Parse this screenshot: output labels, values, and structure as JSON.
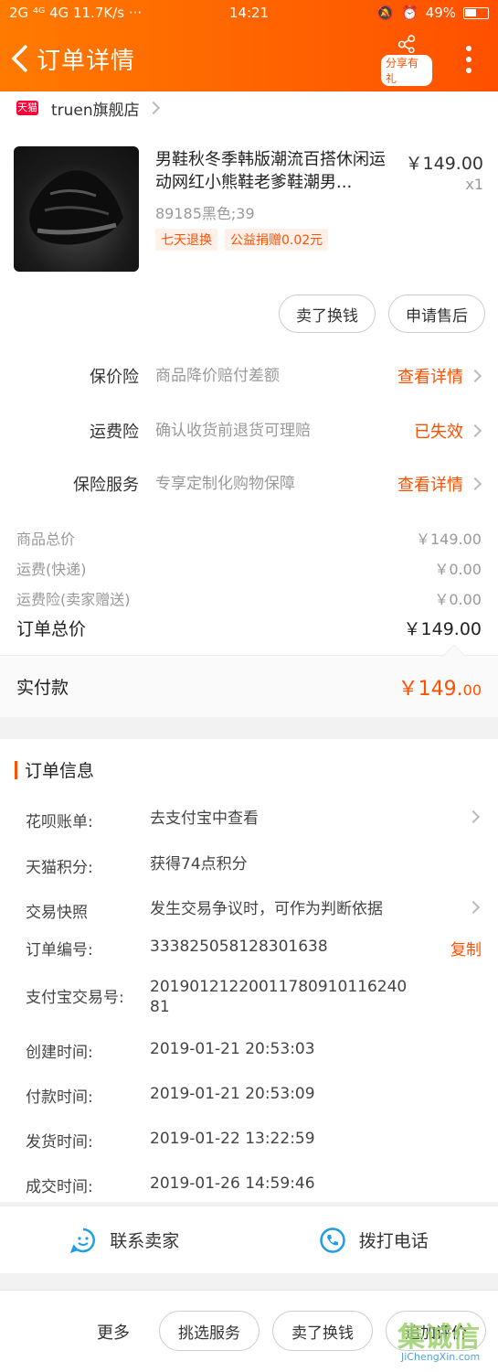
{
  "status": {
    "left": "2G ⁴ᴳ 4G 11.7K/s ···",
    "time": "14:21",
    "battery": "49%"
  },
  "nav": {
    "title": "订单详情",
    "share_label": "分享有礼"
  },
  "shop": {
    "badge": "天猫",
    "name": "truen旗舰店"
  },
  "product": {
    "title": "男鞋秋冬季韩版潮流百搭休闲运动网红小熊鞋老爹鞋潮男...",
    "price": "￥149.00",
    "qty": "x1",
    "sku": "89185黑色;39",
    "tags": [
      "七天退换",
      "公益捐赠0.02元"
    ],
    "buttons": [
      "卖了换钱",
      "申请售后"
    ]
  },
  "insurance": [
    {
      "label": "保价险",
      "desc": "商品降价赔付差额",
      "link": "查看详情"
    },
    {
      "label": "运费险",
      "desc": "确认收货前退货可理赔",
      "link": "已失效"
    },
    {
      "label": "保险服务",
      "desc": "专享定制化购物保障",
      "link": "查看详情"
    }
  ],
  "fees": [
    {
      "label": "商品总价",
      "value": "￥149.00"
    },
    {
      "label": "运费(快递)",
      "value": "￥0.00"
    },
    {
      "label": "运费险(卖家赠送)",
      "value": "￥0.00"
    }
  ],
  "total": {
    "label": "订单总价",
    "value": "￥149.00"
  },
  "paid": {
    "label": "实付款",
    "value_main": "￥149.",
    "value_cents": "00"
  },
  "order_info": {
    "heading": "订单信息",
    "rows": [
      {
        "k": "花呗账单:",
        "v": "去支付宝中查看"
      },
      {
        "k": "天猫积分:",
        "v": "获得74点积分"
      },
      {
        "k": "交易快照",
        "v": "发生交易争议时，可作为判断依据"
      },
      {
        "k": "订单编号:",
        "v": "333825058128301638",
        "action": "复制"
      },
      {
        "k": "支付宝交易号:",
        "v": "2019012122001178091011624081"
      },
      {
        "k": "创建时间:",
        "v": "2019-01-21 20:53:03"
      },
      {
        "k": "付款时间:",
        "v": "2019-01-21 20:53:09"
      },
      {
        "k": "发货时间:",
        "v": "2019-01-22 13:22:59"
      },
      {
        "k": "成交时间:",
        "v": "2019-01-26 14:59:46"
      }
    ]
  },
  "contact": {
    "seller": "联系卖家",
    "phone": "拨打电话"
  },
  "bottom": {
    "more": "更多",
    "btn1": "挑选服务",
    "btn2": "卖了换钱",
    "btn3": "追加评价"
  },
  "watermark": {
    "big": "集诚信",
    "small": "JiChengXin.com"
  },
  "colors": {
    "accent": "#ff5000",
    "link_blue": "#1e9de8"
  }
}
